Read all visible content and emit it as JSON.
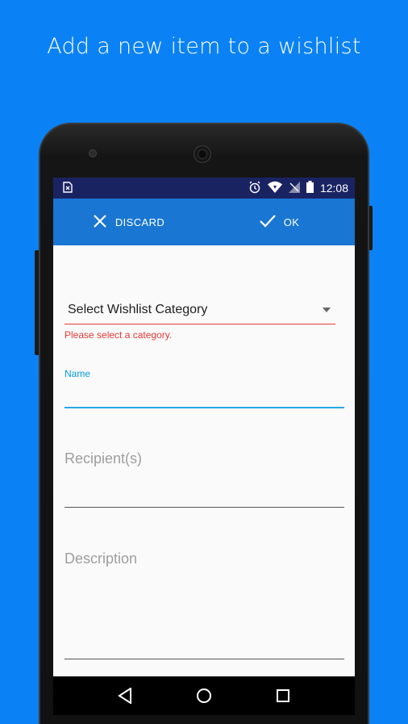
{
  "headline": "Add a new item to a wishlist",
  "statusbar": {
    "time": "12:08",
    "icons": [
      "sim-card-icon",
      "alarm-icon",
      "wifi-icon",
      "no-signal-icon",
      "battery-icon"
    ]
  },
  "actionbar": {
    "discard_label": "DISCARD",
    "ok_label": "OK"
  },
  "form": {
    "category": {
      "selected_value": "Select Wishlist Category",
      "error": "Please select a category."
    },
    "name": {
      "label": "Name",
      "value": ""
    },
    "recipients": {
      "placeholder": "Recipient(s)"
    },
    "description": {
      "placeholder": "Description"
    }
  },
  "colors": {
    "background": "#0A82F5",
    "status_bar": "#1A2362",
    "action_bar": "#1976D2",
    "error": "#E53935",
    "accent": "#039BE5"
  }
}
